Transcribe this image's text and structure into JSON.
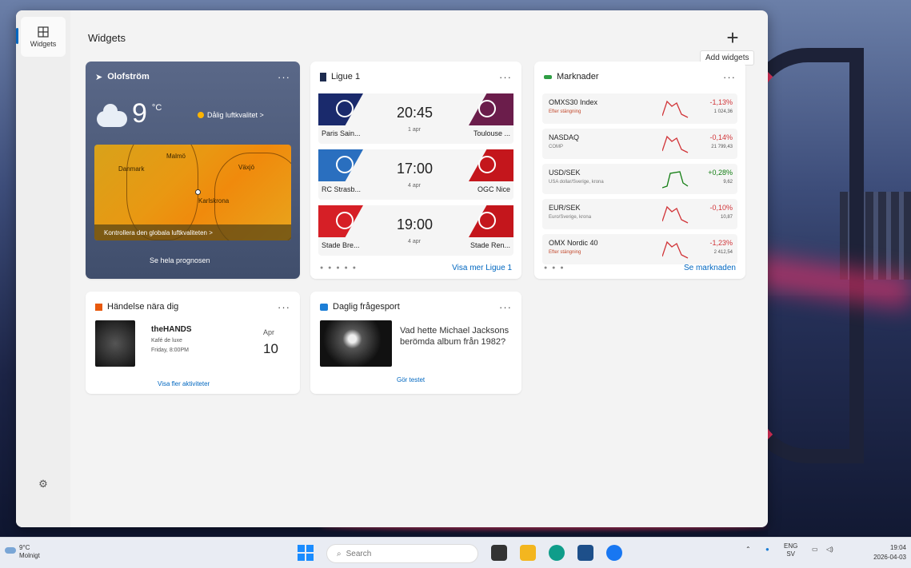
{
  "header": {
    "title": "Widgets",
    "add_tooltip": "Add widgets",
    "rail_label": "Widgets"
  },
  "weather": {
    "location": "Olofström",
    "temp": "9",
    "unit": "°C",
    "link": "Dålig luftkvalitet >",
    "map_labels": [
      "Danmark",
      "Malmö",
      "Växjö",
      "Karlskrona"
    ],
    "map_bar": "Kontrollera den globala luftkvaliteten >",
    "footer": "Se hela prognosen"
  },
  "ligue": {
    "title": "Ligue 1",
    "matches": [
      {
        "home": "Paris Sain...",
        "away": "Toulouse ...",
        "time": "20:45",
        "date": "1 apr",
        "home_color": "#1a2a6c",
        "away_color": "#6b1d4b"
      },
      {
        "home": "RC Strasb...",
        "away": "OGC Nice",
        "time": "17:00",
        "date": "4 apr",
        "home_color": "#2a6fbf",
        "away_color": "#c4161c"
      },
      {
        "home": "Stade Bre...",
        "away": "Stade Ren...",
        "time": "19:00",
        "date": "4 apr",
        "home_color": "#d61f26",
        "away_color": "#c4161c"
      }
    ],
    "link": "Visa mer Ligue 1"
  },
  "market": {
    "title": "Marknader",
    "rows": [
      {
        "name": "OMXS30 Index",
        "sub": "Efter stängning",
        "pct": "-1,13%",
        "val": "1 024,36",
        "dir": "down"
      },
      {
        "name": "NASDAQ",
        "sub": "COMP",
        "pct": "-0,14%",
        "val": "21 799,43",
        "dir": "down"
      },
      {
        "name": "USD/SEK",
        "sub": "USA dollar/Sverige, krona",
        "pct": "+0,28%",
        "val": "9,62",
        "dir": "up"
      },
      {
        "name": "EUR/SEK",
        "sub": "Euro/Sverige, krona",
        "pct": "-0,10%",
        "val": "10,87",
        "dir": "down"
      },
      {
        "name": "OMX Nordic 40",
        "sub": "Efter stängning",
        "pct": "-1,23%",
        "val": "2 412,54",
        "dir": "down"
      }
    ],
    "link": "Se marknaden"
  },
  "events": {
    "title": "Händelse nära dig",
    "name": "theHANDS",
    "venue": "Kafé de luxe",
    "time": "Friday, 8:00PM",
    "month": "Apr",
    "day": "10",
    "link": "Visa fler aktiviteter"
  },
  "quiz": {
    "title": "Daglig frågesport",
    "question": "Vad hette Michael Jacksons berömda album från 1982?",
    "link": "Gör testet"
  },
  "taskbar": {
    "temp": "9°C",
    "cond": "Molnigt",
    "search": "Search",
    "lang": "ENG",
    "lang2": "SV",
    "time": "19:04",
    "date": "2026-04-03"
  },
  "colors": {
    "accent": "#0067c0",
    "down": "#d13438",
    "up": "#107c10"
  }
}
